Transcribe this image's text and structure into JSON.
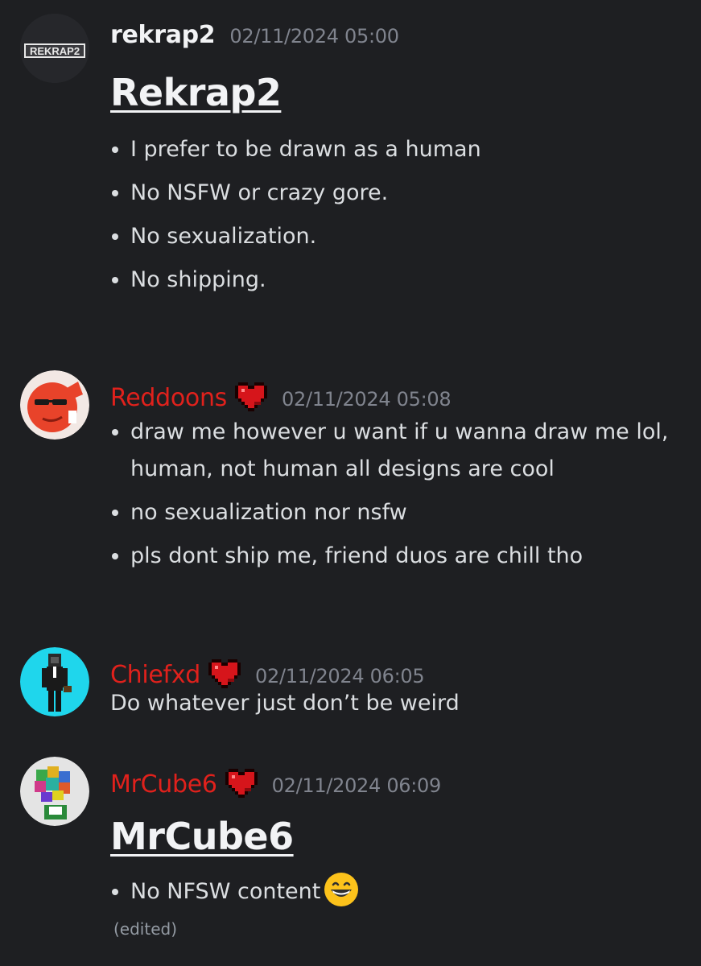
{
  "messages": [
    {
      "username": "rekrap2",
      "timestamp": "02/11/2024 05:00",
      "avatar_text": "REKRAP2",
      "heading": "Rekrap2",
      "bullets": [
        "I prefer to be drawn as a human",
        "No NSFW or crazy gore.",
        "No sexualization.",
        "No shipping."
      ]
    },
    {
      "username": "Reddoons",
      "timestamp": "02/11/2024 05:08",
      "badge_icon": "pixel-heart-icon",
      "bullets": [
        "draw me however u want if u wanna draw me lol, human, not human all designs are cool",
        "no sexualization nor nsfw",
        "pls dont ship me, friend duos are chill tho"
      ]
    },
    {
      "username": "Chiefxd",
      "timestamp": "02/11/2024 06:05",
      "badge_icon": "pixel-heart-icon",
      "text": "Do whatever just don’t be weird"
    },
    {
      "username": "MrCube6",
      "timestamp": "02/11/2024 06:09",
      "badge_icon": "pixel-heart-icon",
      "heading": "MrCube6",
      "bullets": [
        "No NFSW content"
      ],
      "emoji": "grinning-face-icon",
      "edited": "(edited)"
    }
  ],
  "colors": {
    "background": "#1e1f22",
    "role_red": "#e0211c",
    "timestamp": "#80848e",
    "text": "#dbdee1"
  }
}
